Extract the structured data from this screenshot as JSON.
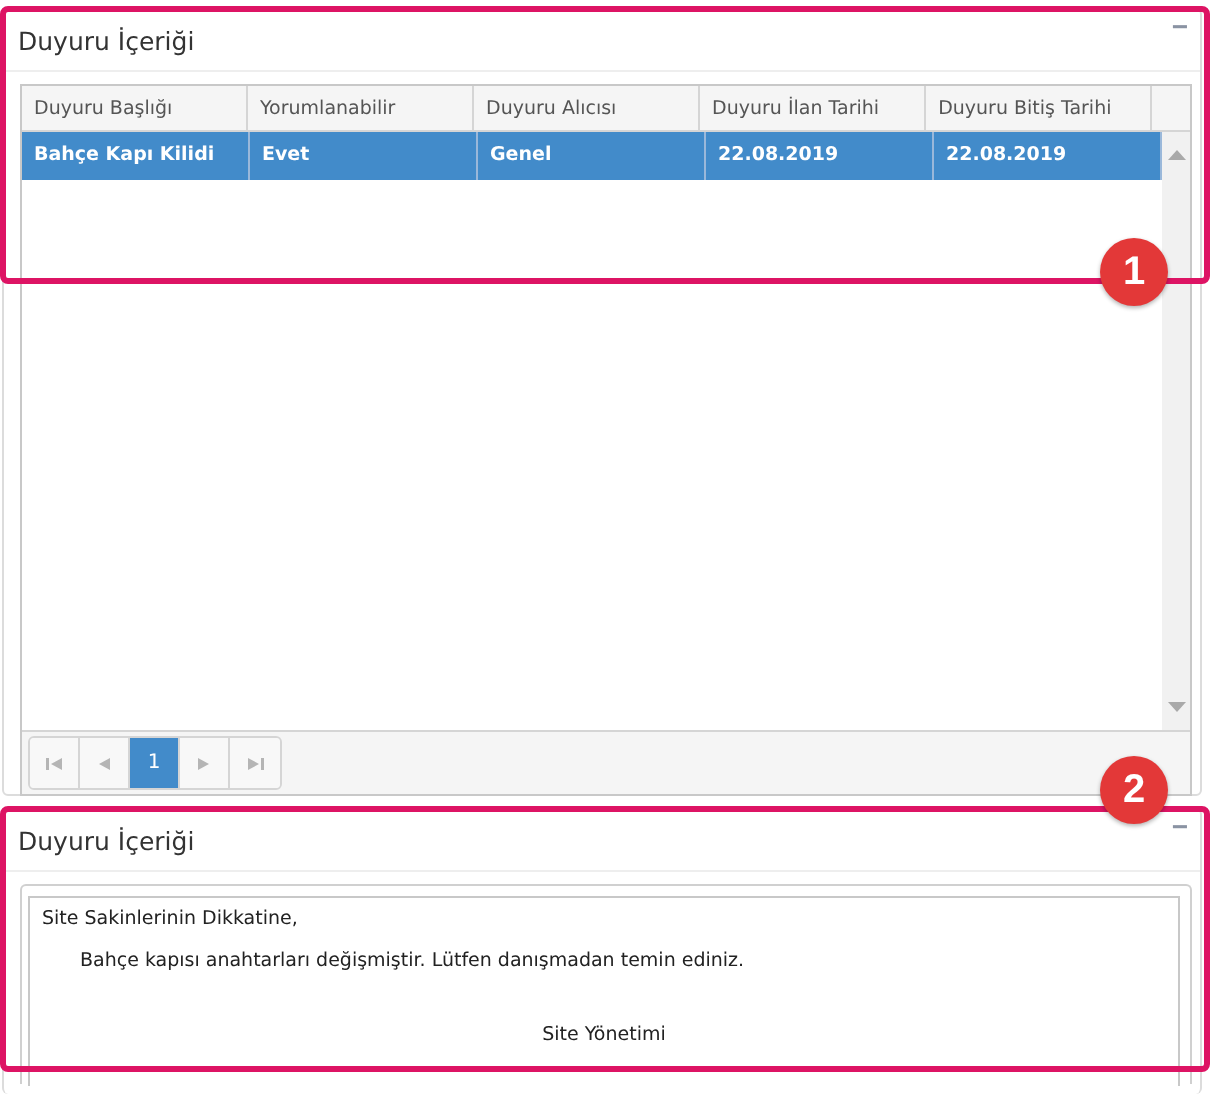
{
  "panels": [
    {
      "title": "Duyuru İçeriği",
      "collapse": "−",
      "kind": "grid",
      "table": {
        "columns": [
          "Duyuru Başlığı",
          "Yorumlanabilir",
          "Duyuru Alıcısı",
          "Duyuru İlan Tarihi",
          "Duyuru Bitiş Tarihi"
        ],
        "rows": [
          {
            "cells": [
              "Bahçe Kapı Kilidi",
              "Evet",
              "Genel",
              "22.08.2019",
              "22.08.2019"
            ],
            "selected": true
          }
        ]
      },
      "pager": {
        "pages": [
          {
            "label": "1",
            "selected": true
          }
        ]
      }
    },
    {
      "title": "Duyuru İçeriği",
      "collapse": "−",
      "kind": "content",
      "content": {
        "greeting": "Site Sakinlerinin Dikkatine,",
        "body": "Bahçe kapısı anahtarları değişmiştir. Lütfen danışmadan temin ediniz.",
        "signature": "Site Yönetimi"
      }
    }
  ],
  "annotations": [
    {
      "label": "1"
    },
    {
      "label": "2"
    }
  ]
}
